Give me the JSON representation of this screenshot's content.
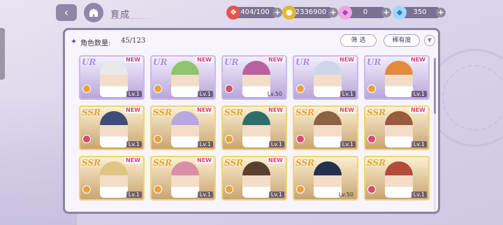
{
  "header": {
    "title": "育成",
    "resources": [
      {
        "name": "stamina",
        "value": "404/100",
        "icon": "stamina-candy-icon"
      },
      {
        "name": "gold",
        "value": "2336900",
        "icon": "coin-icon"
      },
      {
        "name": "pink-gem",
        "value": "0",
        "icon": "pink-diamond-icon"
      },
      {
        "name": "blue-gem",
        "value": "350",
        "icon": "blue-diamond-icon"
      }
    ]
  },
  "panel": {
    "count_label": "角色数量:",
    "count_value": "45/123",
    "filter_label": "筛 选",
    "rarity_label": "稀有度"
  },
  "cards": [
    {
      "rarity": "UR",
      "badge": "NEW",
      "level": "Lv.1",
      "attr_color": "#e8a23a",
      "hair": "#e9e9e9"
    },
    {
      "rarity": "UR",
      "badge": "NEW",
      "level": "Lv.1",
      "attr_color": "#e8a23a",
      "hair": "#8fc46c"
    },
    {
      "rarity": "UR",
      "badge": "NEW",
      "level": "Lv.50",
      "attr_color": "#d94b6a",
      "hair": "#b9609e"
    },
    {
      "rarity": "UR",
      "badge": "NEW",
      "level": "Lv.1",
      "attr_color": "#e8a23a",
      "hair": "#cfd6e6"
    },
    {
      "rarity": "UR",
      "badge": "NEW",
      "level": "Lv.1",
      "attr_color": "#e8a23a",
      "hair": "#e48a3d"
    },
    {
      "rarity": "SSR",
      "badge": "NEW",
      "level": "Lv.1",
      "attr_color": "#d94b6a",
      "hair": "#3e4d7a"
    },
    {
      "rarity": "SSR",
      "badge": "NEW",
      "level": "Lv.1",
      "attr_color": "#e8a23a",
      "hair": "#b9a7e3"
    },
    {
      "rarity": "SSR",
      "badge": "NEW",
      "level": "Lv.1",
      "attr_color": "#e8a23a",
      "hair": "#2c6e6a"
    },
    {
      "rarity": "SSR",
      "badge": "NEW",
      "level": "Lv.1",
      "attr_color": "#d94b6a",
      "hair": "#8c6244"
    },
    {
      "rarity": "SSR",
      "badge": "NEW",
      "level": "Lv.1",
      "attr_color": "#d94b6a",
      "hair": "#9a5a3d"
    },
    {
      "rarity": "SSR",
      "badge": "NEW",
      "level": "Lv.1",
      "attr_color": "#e8a23a",
      "hair": "#e0c483"
    },
    {
      "rarity": "SSR",
      "badge": "NEW",
      "level": "Lv.1",
      "attr_color": "#e8a23a",
      "hair": "#d98fa8"
    },
    {
      "rarity": "SSR",
      "badge": "NEW",
      "level": "Lv.1",
      "attr_color": "#e8a23a",
      "hair": "#5a4031"
    },
    {
      "rarity": "SSR",
      "badge": "",
      "level": "Lv.50",
      "attr_color": "#e8a23a",
      "hair": "#23304f"
    },
    {
      "rarity": "SSR",
      "badge": "",
      "level": "Lv.1",
      "attr_color": "#d94b6a",
      "hair": "#b34a3a"
    }
  ]
}
